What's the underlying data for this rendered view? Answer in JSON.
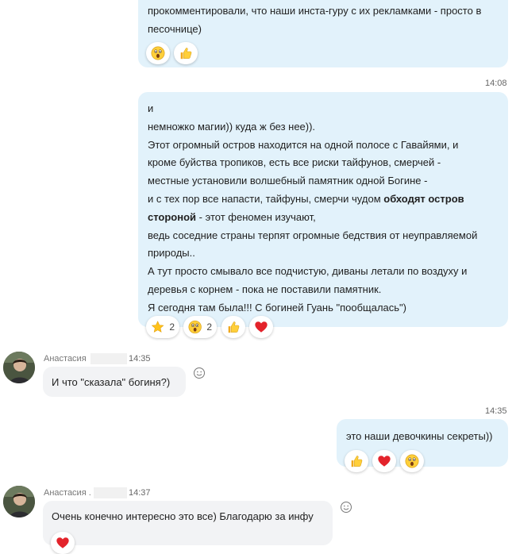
{
  "message1": {
    "lines": [
      "прокомментировали, что наши инста-гуру с их рекламками - просто в",
      "песочнице)"
    ]
  },
  "message2": {
    "time": "14:08",
    "lines": [
      "и",
      "немножко магии)) куда ж без нее)).",
      "Этот огромный остров находится на одной полосе с Гавайями, и",
      "кроме буйства тропиков, есть все риски тайфунов, смерчей -",
      "местные установили волшебный памятник одной Богине -"
    ],
    "line6_prefix": "и с тех пор все напасти, тайфуны, смерчи чудом ",
    "line6_bold": "обходят остров",
    "line7_bold": "стороной",
    "line7_suffix": " - этот феномен изучают,",
    "lines_after": [
      "ведь соседние страны терпят огромные бедствия от неуправляемой",
      "природы..",
      "А тут просто смывало все подчистую, диваны летали по воздуху и",
      "деревья с корнем - пока не поставили памятник.",
      "Я сегодня там была!!! С богиней Гуань \"пообщалась\")"
    ],
    "reactions": [
      {
        "icon": "star-icon",
        "count": "2"
      },
      {
        "icon": "surprised-face-icon",
        "count": "2"
      },
      {
        "icon": "thumbs-up-icon"
      },
      {
        "icon": "heart-icon"
      }
    ]
  },
  "message3": {
    "sender": "Анастасия",
    "time": "14:35",
    "text": "И что \"сказала\" богиня?)"
  },
  "message4": {
    "time": "14:35",
    "text": "это наши девочкины секреты))"
  },
  "message5": {
    "sender": "Анастасия .",
    "time": "14:37",
    "text": "Очень конечно интересно это все) Благодарю за инфу"
  },
  "colors": {
    "outgoing_bubble": "#e2f2fb",
    "incoming_bubble": "#f2f3f5",
    "heart": "#e3232b",
    "emoji_yellow": "#ffcf3a"
  }
}
